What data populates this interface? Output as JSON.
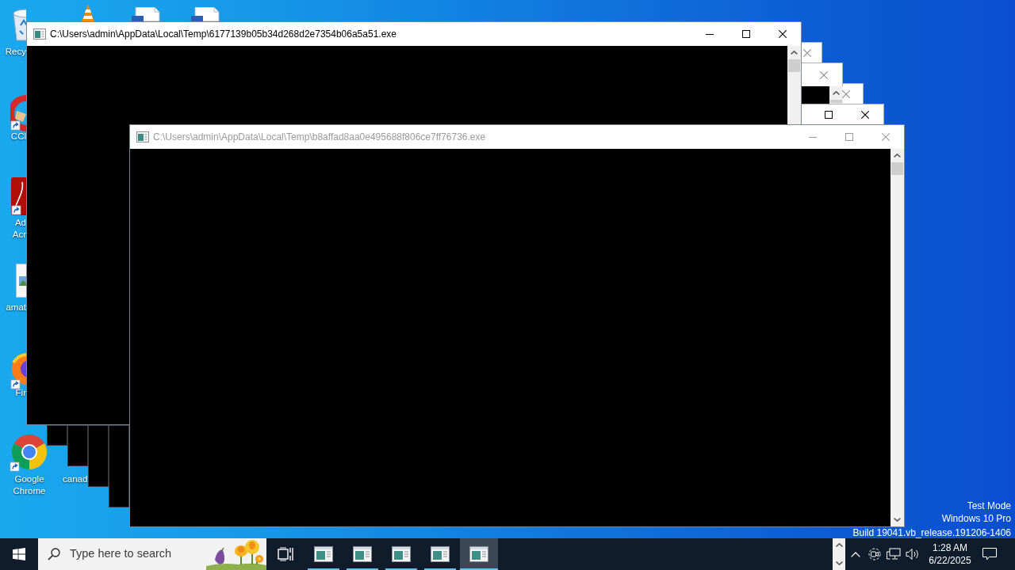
{
  "desktop_icons": [
    {
      "kind": "recycle_bin",
      "label_lines": [
        "Recy"
      ]
    },
    {
      "kind": "vlc"
    },
    {
      "kind": "document"
    },
    {
      "kind": "document"
    },
    {
      "kind": "ccleaner",
      "label_lines": [
        "CCl"
      ]
    },
    {
      "kind": "acrobat",
      "label_lines": [
        "Ad",
        "Acr"
      ]
    },
    {
      "kind": "image_file",
      "label_lines": [
        "amat"
      ]
    },
    {
      "kind": "firefox",
      "label_lines": [
        "Fir"
      ]
    },
    {
      "kind": "chrome",
      "label_lines": [
        "Google",
        "Chrome"
      ]
    },
    {
      "label_lines": [
        "canad"
      ]
    }
  ],
  "background_windows": [
    {
      "active": false,
      "controls": [
        {
          "kind": "close"
        }
      ]
    },
    {
      "active": false,
      "controls": [
        {
          "kind": "close"
        },
        {
          "kind": "scroll_up"
        }
      ]
    },
    {
      "active": false,
      "controls": [
        {
          "kind": "close"
        }
      ]
    },
    {
      "active": true,
      "controls": [
        {
          "kind": "maximize"
        },
        {
          "kind": "close"
        }
      ]
    }
  ],
  "windows": [
    {
      "title": "C:\\Users\\admin\\AppData\\Local\\Temp\\6177139b05b34d268d2e7354b06a5a51.exe",
      "active": true
    },
    {
      "title": "C:\\Users\\admin\\AppData\\Local\\Temp\\b8affad8aa0e495688f806ce7ff76736.exe",
      "active": false
    }
  ],
  "system_notice": [
    "Test Mode",
    "Windows 10 Pro",
    "Build 19041.vb_release.191206-1406"
  ],
  "stray_scrollbar": true,
  "taskbar": {
    "search": {
      "placeholder": "Type here to search"
    },
    "apps": [
      {
        "selected": false,
        "running": true
      },
      {
        "selected": false,
        "running": true
      },
      {
        "selected": false,
        "running": true
      },
      {
        "selected": false,
        "running": true
      },
      {
        "selected": true,
        "running": true
      }
    ],
    "clock": {
      "time": "1:28 AM",
      "date": "6/22/2025"
    }
  }
}
